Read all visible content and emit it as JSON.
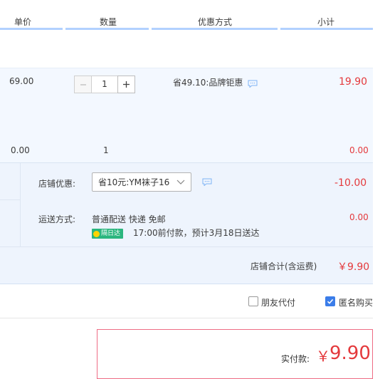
{
  "header": {
    "col_unit_price": "单价",
    "col_quantity": "数量",
    "col_discount": "优惠方式",
    "col_subtotal": "小计"
  },
  "item": {
    "unit_price": "69.00",
    "quantity": "1",
    "discount_text": "省49.10:品牌钜惠",
    "subtotal": "19.90"
  },
  "sub_item": {
    "unit_price": "0.00",
    "quantity": "1",
    "subtotal": "0.00"
  },
  "shop": {
    "discount_label": "店铺优惠:",
    "discount_selected": "省10元:YM袜子16",
    "discount_amount": "-10.00",
    "shipping_label": "运送方式:",
    "shipping_method": "普通配送 快递 免邮",
    "badge_text": "隔日达",
    "delivery_note": "17:00前付款，预计3月18日送达",
    "shipping_fee": "0.00",
    "total_label": "店铺合计(含运费)",
    "total_amount": "￥9.90"
  },
  "options": {
    "friend_pay_label": "朋友代付",
    "friend_pay_checked": false,
    "anonymous_label": "匿名购买",
    "anonymous_checked": true
  },
  "payment": {
    "label": "实付款:",
    "currency": "￥",
    "amount": "9.90"
  },
  "colors": {
    "accent_red": "#e4393c",
    "header_line": "#b2d1ff",
    "item_bg": "#f3f8ff",
    "shop_bg": "#eef4fd",
    "badge_green": "#2bb67e",
    "checkbox_blue": "#3b7de9"
  },
  "icons": {
    "message": "message-bubble-icon",
    "chevron": "chevron-down-icon",
    "minus": "minus-icon",
    "plus": "plus-icon",
    "check": "checkmark-icon"
  }
}
